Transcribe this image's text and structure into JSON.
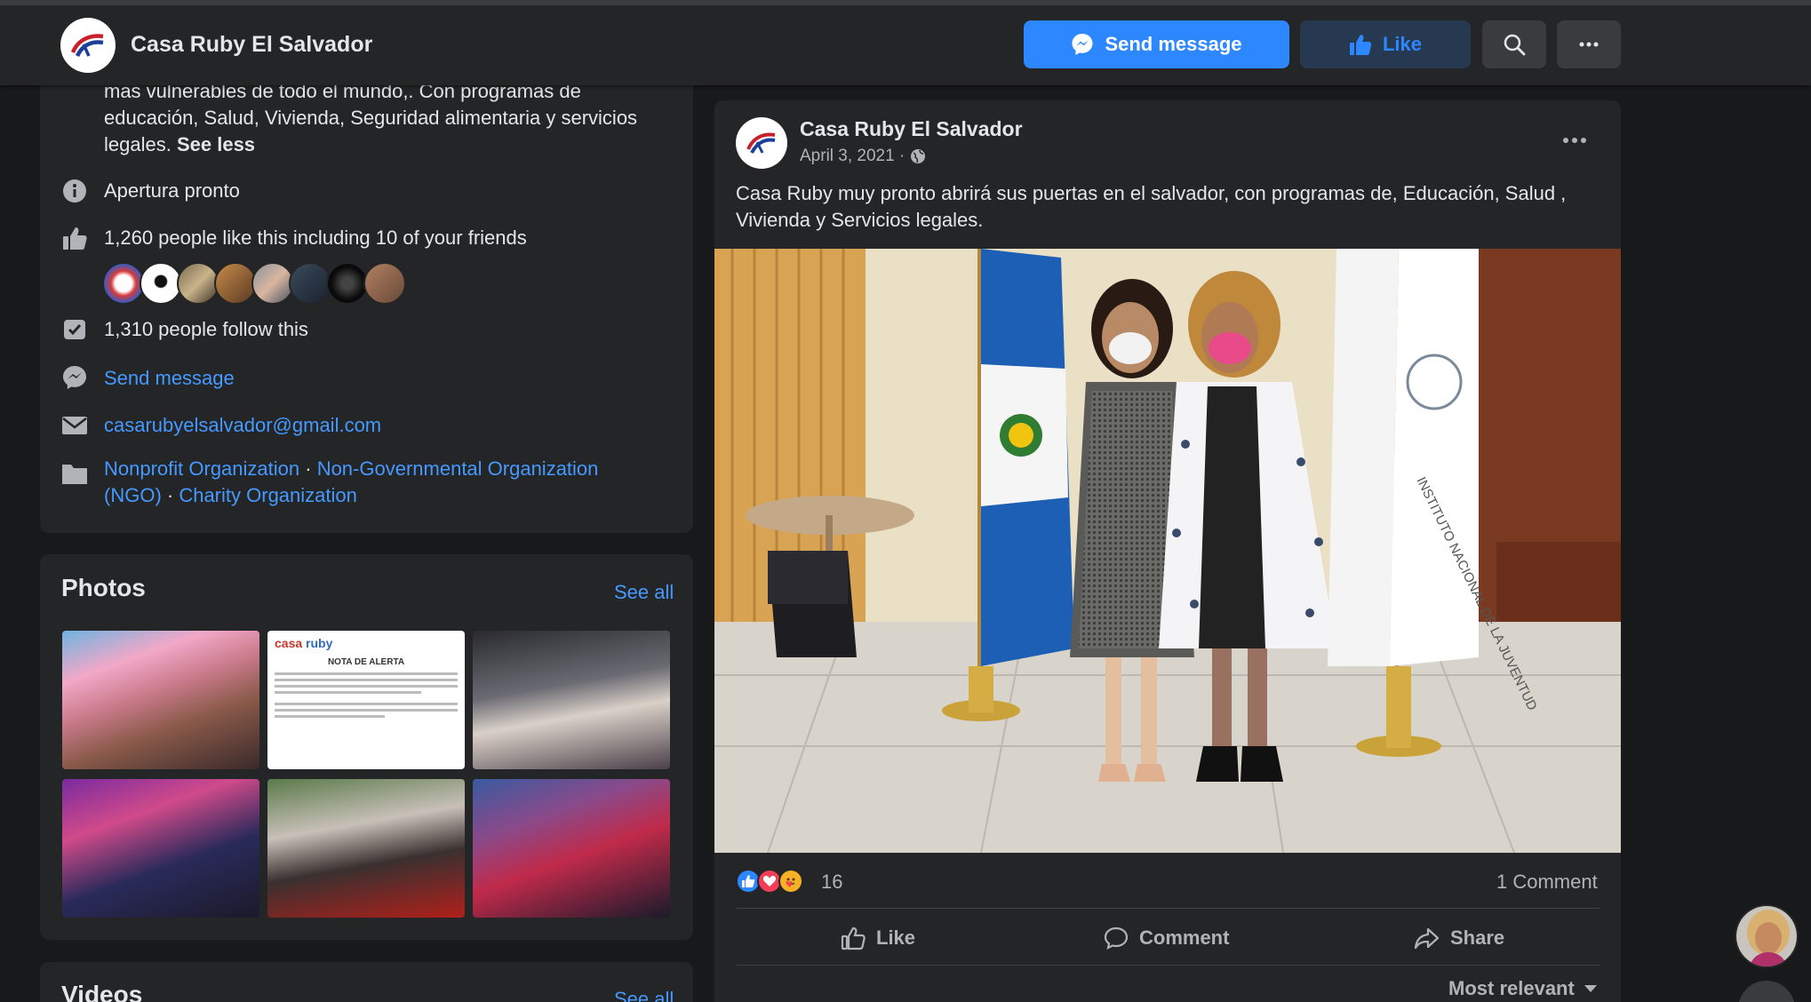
{
  "header": {
    "page_name": "Casa Ruby El Salvador",
    "send_message_label": "Send message",
    "like_label": "Like"
  },
  "about": {
    "description_lines": [
      "mas vulnerables de todo el mundo,. Con programas de",
      "educación, Salud, Vivienda, Seguridad alimentaria y servicios",
      "legales."
    ],
    "see_less": "See less",
    "status": "Apertura pronto",
    "likes": "1,260 people like this including 10 of your friends",
    "follows": "1,310 people follow this",
    "send_message": "Send message",
    "email": "casarubyelsalvador@gmail.com",
    "categories": {
      "cat1": "Nonprofit Organization",
      "sep1": " · ",
      "cat2": "Non-Governmental Organization",
      "cat2b": "(NGO)",
      "sep2": " · ",
      "cat3": "Charity Organization"
    }
  },
  "photos": {
    "title": "Photos",
    "see_all": "See all",
    "alert_doc": {
      "brand_a": "casa",
      "brand_b": "ruby",
      "heading": "NOTA DE ALERTA"
    }
  },
  "videos": {
    "title": "Videos",
    "see_all": "See all"
  },
  "post": {
    "author": "Casa Ruby El Salvador",
    "date": "April 3, 2021 · ",
    "text": "Casa Ruby muy pronto abrirá sus puertas en el salvador, con programas de, Educación, Salud , Vivienda y Servicios legales.",
    "flag_text": "INSTITUTO NACIONAL DE LA JUVENTUD",
    "reaction_count": "16",
    "comment_count": "1 Comment",
    "actions": {
      "like": "Like",
      "comment": "Comment",
      "share": "Share"
    },
    "sort_label": "Most relevant"
  },
  "colors": {
    "accent": "#2d88ff",
    "link": "#4599ff",
    "background": "#18191a",
    "card": "#242526"
  }
}
